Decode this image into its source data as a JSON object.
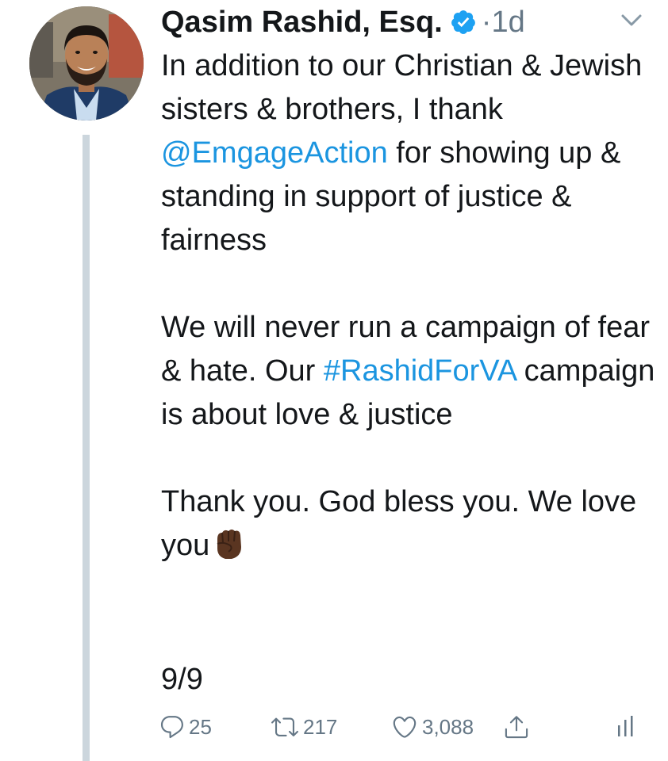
{
  "tweet": {
    "display_name": "Qasim Rashid, Esq.",
    "separator": "·",
    "timestamp": "1d",
    "verified": true,
    "body": {
      "p1_a": "In addition to our Christian & Jewish sisters & brothers, I thank ",
      "p1_mention": "@EmgageAction",
      "p1_b": " for showing up & standing in support of justice & fairness",
      "p2_a": "We will never run a campaign of fear & hate. Our ",
      "p2_hashtag": "#RashidForVA",
      "p2_b": " campaign is about love & justice",
      "p3": "Thank you. God bless you. We love you",
      "emoji": "raised-fist-dark-skin-tone"
    },
    "thread_counter": "9/9",
    "actions": {
      "replies": "25",
      "retweets": "217",
      "likes": "3,088"
    }
  },
  "colors": {
    "link": "#1b95e0",
    "verified": "#1da1f2",
    "muted": "#657786",
    "thread_line": "#ccd6dd",
    "text": "#14171a"
  },
  "icons": {
    "caret": "chevron-down-icon",
    "reply": "reply-icon",
    "retweet": "retweet-icon",
    "like": "heart-icon",
    "share": "share-icon",
    "analytics": "analytics-icon",
    "verified": "verified-badge-icon"
  }
}
